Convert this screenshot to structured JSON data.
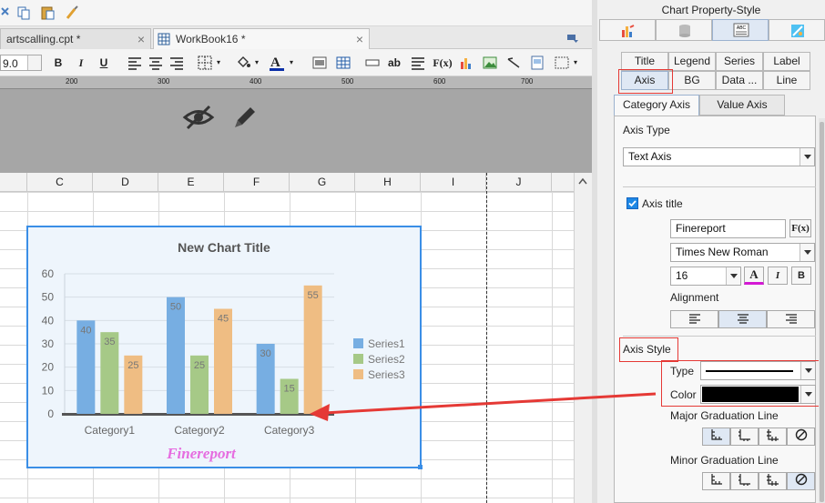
{
  "doc_tabs": [
    {
      "label": "artscalling.cpt *",
      "close": "×",
      "active": false
    },
    {
      "label": "WorkBook16 *",
      "close": "×",
      "active": true
    }
  ],
  "format_bar": {
    "font_size": "9.0",
    "bold": "B",
    "italic": "I",
    "underline": "U",
    "text_btn": "ab",
    "formula_btn": "F(x)"
  },
  "ruler": {
    "ticks": [
      "200",
      "300",
      "400",
      "500",
      "600",
      "700"
    ]
  },
  "columns": [
    {
      "label": "C",
      "selected": true
    },
    {
      "label": "D",
      "selected": true
    },
    {
      "label": "E",
      "selected": true
    },
    {
      "label": "F",
      "selected": true
    },
    {
      "label": "G",
      "selected": true
    },
    {
      "label": "H",
      "selected": true
    },
    {
      "label": "I",
      "selected": false
    },
    {
      "label": "J",
      "selected": false
    }
  ],
  "chart_data": {
    "type": "bar",
    "title": "New Chart Title",
    "categories": [
      "Category1",
      "Category2",
      "Category3"
    ],
    "series": [
      {
        "name": "Series1",
        "values": [
          40,
          50,
          30
        ],
        "color": "#77aee2"
      },
      {
        "name": "Series2",
        "values": [
          35,
          25,
          15
        ],
        "color": "#a6c987"
      },
      {
        "name": "Series3",
        "values": [
          25,
          45,
          55
        ],
        "color": "#efbd83"
      }
    ],
    "ylim": [
      0,
      60
    ],
    "yticks": [
      "0",
      "10",
      "20",
      "30",
      "40",
      "50",
      "60"
    ],
    "axis_title": "Finereport",
    "legend": "right"
  },
  "panel": {
    "title": "Chart Property-Style",
    "subtabs_row1": [
      "Title",
      "Legend",
      "Series",
      "Label"
    ],
    "subtabs_row2": [
      "Axis",
      "BG",
      "Data ...",
      "Line"
    ],
    "axis_tabs": [
      "Category Axis",
      "Value Axis"
    ],
    "axis_type_label": "Axis Type",
    "axis_type_value": "Text Axis",
    "axis_title_checkbox": "Axis title",
    "axis_title_value": "Finereport",
    "font_name": "Times New Roman",
    "font_size": "16",
    "alignment_label": "Alignment",
    "axis_style_label": "Axis Style",
    "type_label": "Type",
    "color_label": "Color",
    "major_grad_label": "Major Graduation Line",
    "minor_grad_label": "Minor Graduation Line",
    "fx_btn": "F(x)",
    "italic_btn": "I",
    "bold_btn": "B",
    "font_color_btn": "A"
  }
}
